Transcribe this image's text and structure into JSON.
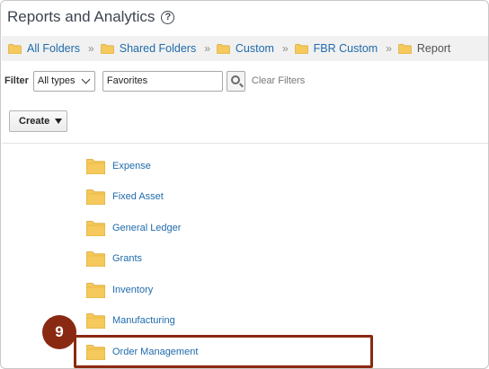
{
  "page": {
    "title": "Reports and Analytics",
    "help_icon": "help-circle-icon",
    "help_glyph": "?"
  },
  "breadcrumb": {
    "items": [
      {
        "label": "All Folders",
        "icon": "folder-icon"
      },
      {
        "label": "Shared Folders",
        "icon": "folder-icon"
      },
      {
        "label": "Custom",
        "icon": "folder-icon"
      },
      {
        "label": "FBR Custom",
        "icon": "folder-icon"
      },
      {
        "label": "Report",
        "icon": "folder-icon"
      }
    ],
    "separator": "»"
  },
  "filter": {
    "label": "Filter",
    "type_select_value": "All types",
    "search_value": "Favorites",
    "clear_label": "Clear Filters"
  },
  "toolbar": {
    "create_label": "Create"
  },
  "folders": [
    {
      "label": "Expense"
    },
    {
      "label": "Fixed Asset"
    },
    {
      "label": "General Ledger"
    },
    {
      "label": "Grants"
    },
    {
      "label": "Inventory"
    },
    {
      "label": "Manufacturing"
    },
    {
      "label": "Order Management"
    }
  ],
  "callout": {
    "step_number": "9",
    "color": "#8a2912"
  },
  "colors": {
    "link": "#1f6bab",
    "folder_fill": "#f5c95c",
    "folder_tab": "#e8b43a"
  }
}
